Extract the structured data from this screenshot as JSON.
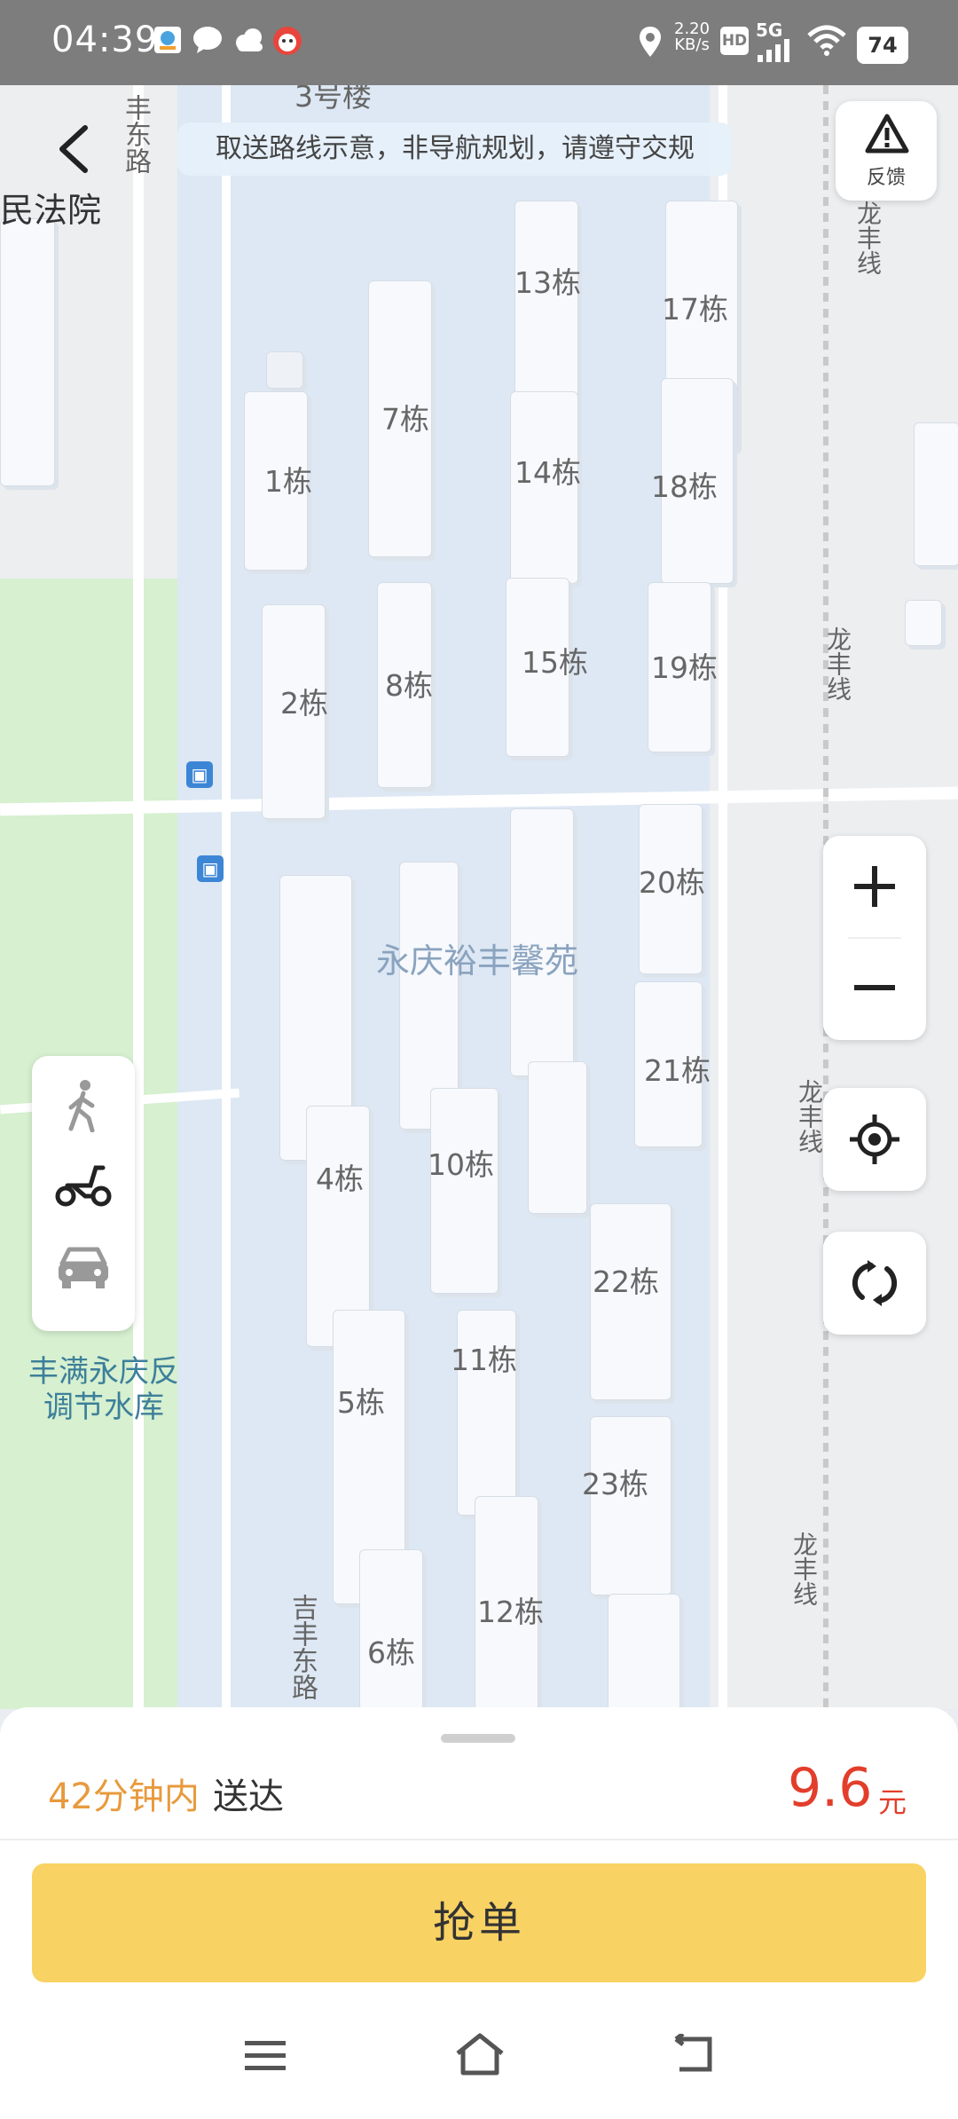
{
  "status_bar": {
    "time": "04:39",
    "speed": "2.20",
    "speed_unit": "KB/s",
    "hd": "HD",
    "network": "5G",
    "battery": "74"
  },
  "map": {
    "notice": "取送路线示意，非导航规划，请遵守交规",
    "feedback_label": "反馈",
    "court_label": "民法院",
    "top_label": "3号楼",
    "road_left": "丰东路",
    "road_left_bottom": "吉丰东路",
    "rail_label": "龙丰线",
    "complex_name": "永庆裕丰馨苑",
    "reservoir": "丰满永庆反调节水库",
    "buildings": {
      "b1": "1栋",
      "b2": "2栋",
      "b4": "4栋",
      "b5": "5栋",
      "b6": "6栋",
      "b7": "7栋",
      "b8": "8栋",
      "b10": "10栋",
      "b11": "11栋",
      "b12": "12栋",
      "b13": "13栋",
      "b14": "14栋",
      "b15": "15栋",
      "b17": "17栋",
      "b18": "18栋",
      "b19": "19栋",
      "b20": "20栋",
      "b21": "21栋",
      "b22": "22栋",
      "b23": "23栋"
    }
  },
  "delivery": {
    "time_highlight": "42分钟内",
    "time_rest": "送达",
    "price": "9.6",
    "price_unit": "元",
    "grab_button": "抢单"
  },
  "colors": {
    "accent": "#f8d263",
    "price": "#e33e2b",
    "time": "#e89a3c",
    "green_area": "#d6f0d0",
    "complex": "#dde8f4"
  }
}
